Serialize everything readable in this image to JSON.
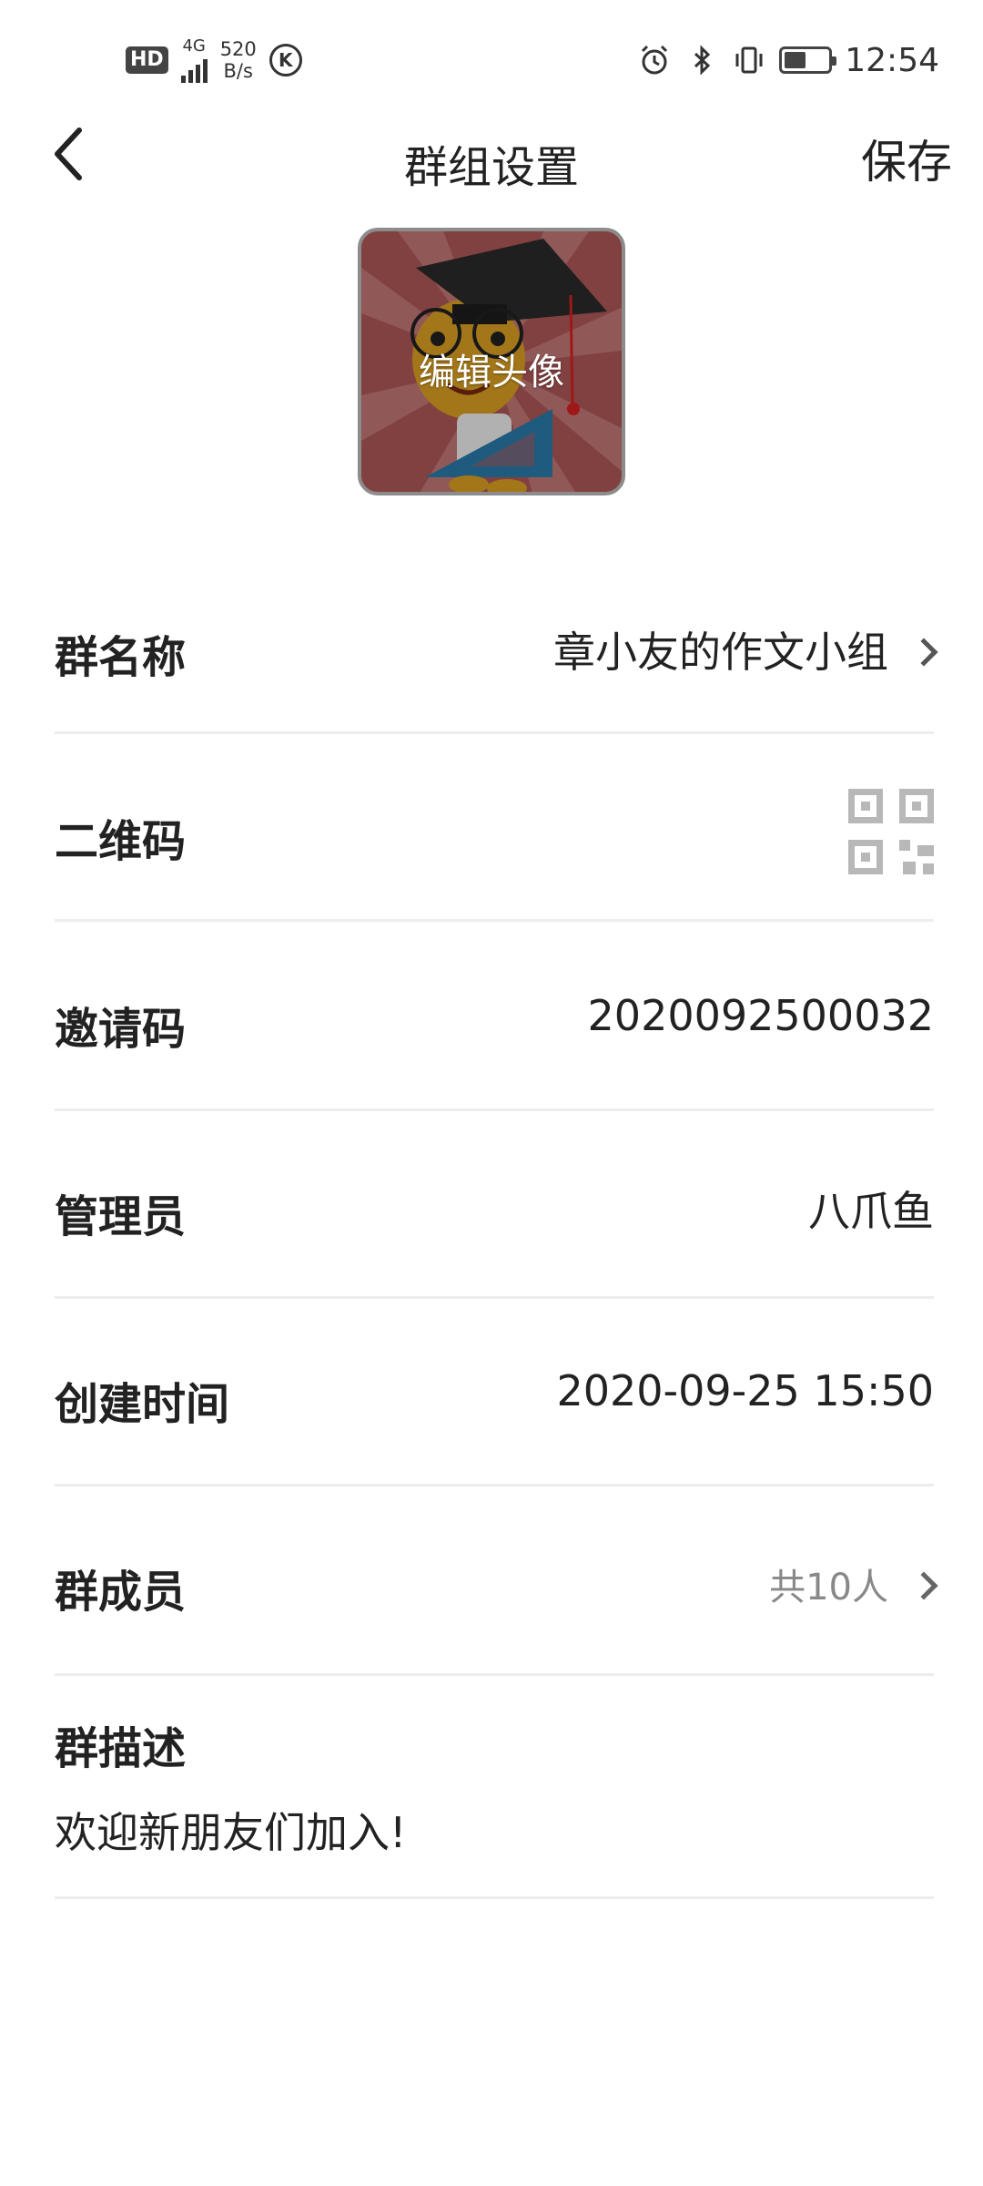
{
  "status_bar": {
    "hd": "HD",
    "network": "4G",
    "speed_value": "520",
    "speed_unit": "B/s",
    "k_badge": "K",
    "time": "12:54",
    "battery_level": 0.5,
    "icons": [
      "hd-icon",
      "signal-icon",
      "k-icon",
      "alarm-icon",
      "bluetooth-icon",
      "vibrate-icon",
      "battery-icon"
    ]
  },
  "header": {
    "title": "群组设置",
    "save_label": "保存",
    "back_icon": "chevron-left-icon"
  },
  "avatar": {
    "edit_label": "编辑头像"
  },
  "rows": {
    "group_name": {
      "label": "群名称",
      "value": "章小友的作文小组"
    },
    "qr_code": {
      "label": "二维码",
      "icon": "qr-code-icon"
    },
    "invite_code": {
      "label": "邀请码",
      "value": "2020092500032"
    },
    "admin": {
      "label": "管理员",
      "value": "八爪鱼"
    },
    "created_time": {
      "label": "创建时间",
      "value": "2020-09-25 15:50"
    },
    "members": {
      "label": "群成员",
      "value": "共10人"
    },
    "description": {
      "label": "群描述",
      "value": "欢迎新朋友们加入!"
    }
  },
  "colors": {
    "background": "#ffffff",
    "text": "#222222",
    "muted": "#888888",
    "divider": "#ededed",
    "avatar_bg": "#b45b5b"
  }
}
